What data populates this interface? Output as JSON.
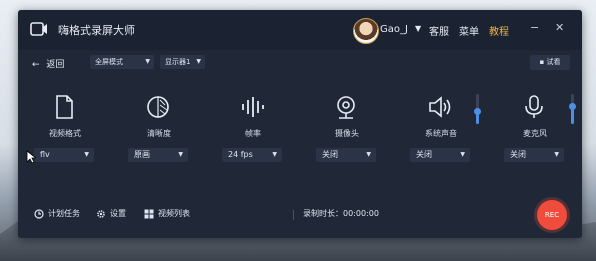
{
  "app": {
    "title": "嗨格式录屏大师"
  },
  "header": {
    "username": "Gao_J",
    "links": [
      {
        "label": "客服"
      },
      {
        "label": "菜单"
      },
      {
        "label": "教程",
        "active": true
      }
    ],
    "window_controls": {
      "minimize": "−",
      "close": "✕"
    }
  },
  "toolbar": {
    "back_label": "返回",
    "mode_select": "全屏模式",
    "display_select": "显示器1",
    "trial_label": "试看"
  },
  "options": [
    {
      "label": "视频格式",
      "select": "flv",
      "icon": "file-icon"
    },
    {
      "label": "清晰度",
      "select": "原画",
      "icon": "clarity-icon"
    },
    {
      "label": "帧率",
      "select": "24 fps",
      "icon": "frame-rate-icon"
    },
    {
      "label": "摄像头",
      "select": "关闭",
      "icon": "webcam-icon"
    },
    {
      "label": "系统声音",
      "select": "关闭",
      "icon": "speaker-icon",
      "volume": 0.45
    },
    {
      "label": "麦克风",
      "select": "关闭",
      "icon": "microphone-icon",
      "volume": 0.6
    }
  ],
  "footer": {
    "schedule_label": "计划任务",
    "settings_label": "设置",
    "video_list_label": "视频列表",
    "duration_label": "录制时长：00:00:00",
    "rec_label": "REC"
  },
  "colors": {
    "accent": "#4d8fe7",
    "rec": "#ef4c3c",
    "active_link": "#f1b33d",
    "window_bg": "#202838"
  }
}
